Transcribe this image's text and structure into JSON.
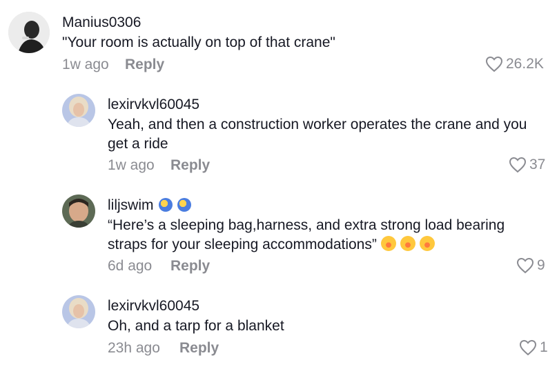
{
  "comments": [
    {
      "username": "Manius0306",
      "text": "\"Your room is actually on top of that crane\"",
      "time": "1w ago",
      "reply_label": "Reply",
      "likes": "26.2K",
      "avatar_icon": "person-avatar"
    },
    {
      "username": "lexirvkvl60045",
      "text": "Yeah, and then a construction worker operates the crane and you get a ride",
      "time": "1w ago",
      "reply_label": "Reply",
      "likes": "37",
      "avatar_icon": "person-avatar"
    },
    {
      "username": "liljswim",
      "text": "“Here’s a sleeping bag,harness, and extra strong load bearing straps for your sleeping accommodations”",
      "time": "6d ago",
      "reply_label": "Reply",
      "likes": "9",
      "avatar_icon": "person-avatar",
      "badges": [
        "fish-emoji",
        "fish-emoji"
      ],
      "emojis": [
        "rolling-laughing-emoji",
        "rolling-laughing-emoji",
        "rolling-laughing-emoji"
      ]
    },
    {
      "username": "lexirvkvl60045",
      "text": "Oh, and a tarp for a blanket",
      "time": "23h ago",
      "reply_label": "Reply",
      "likes": "1",
      "avatar_icon": "person-avatar"
    }
  ],
  "colors": {
    "text": "#161823",
    "muted": "#8a8b91"
  }
}
